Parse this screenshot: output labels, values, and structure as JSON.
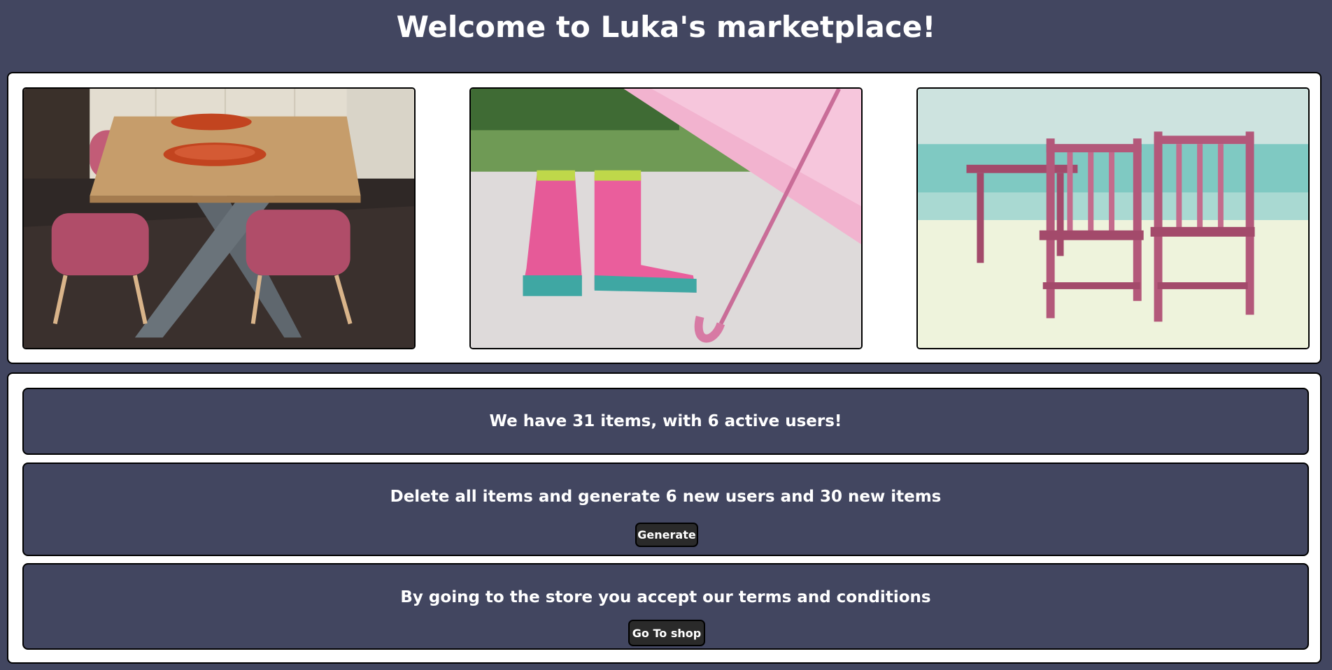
{
  "header": {
    "title": "Welcome to Luka's marketplace!"
  },
  "gallery": {
    "images": [
      {
        "subject": "dining table with pink chairs"
      },
      {
        "subject": "pink rain boots and umbrella"
      },
      {
        "subject": "pink wooden chairs on beach"
      }
    ]
  },
  "stats": {
    "text": "We have 31 items, with 6 active users!"
  },
  "generate": {
    "text": "Delete all items and generate 6 new users and 30 new items",
    "button_label": "Generate"
  },
  "shop": {
    "text": "By going to the store you accept our terms and conditions",
    "button_label": "Go To shop"
  },
  "colors": {
    "background": "#424660",
    "panel": "#ffffff",
    "button": "#2a2a2a",
    "text": "#ffffff"
  }
}
